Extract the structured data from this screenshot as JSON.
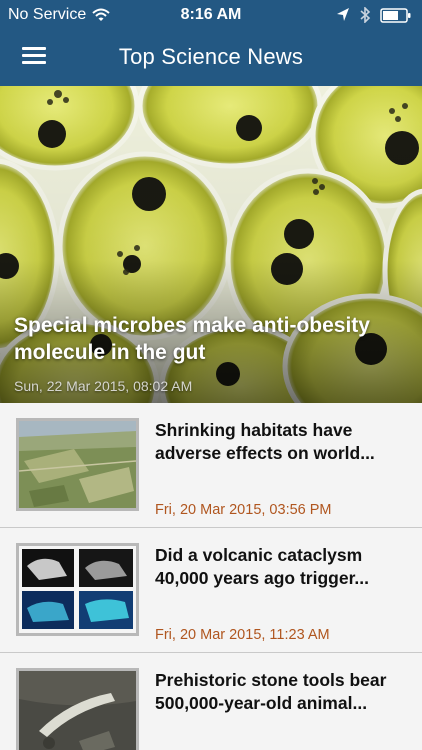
{
  "status_bar": {
    "carrier": "No Service",
    "time": "8:16 AM"
  },
  "nav": {
    "title": "Top Science News"
  },
  "hero": {
    "title": "Special microbes make anti-obesity molecule in the gut",
    "date": "Sun, 22 Mar 2015, 08:02 AM"
  },
  "articles": [
    {
      "title": "Shrinking habitats have adverse effects on world...",
      "date": "Fri, 20 Mar 2015, 03:56 PM"
    },
    {
      "title": "Did a volcanic cataclysm 40,000 years ago trigger...",
      "date": "Fri, 20 Mar 2015, 11:23 AM"
    },
    {
      "title": "Prehistoric stone tools bear 500,000-year-old animal...",
      "date": ""
    }
  ],
  "colors": {
    "header_bg": "#235883",
    "date_accent": "#b0561f",
    "list_bg": "#f4f4f4"
  }
}
